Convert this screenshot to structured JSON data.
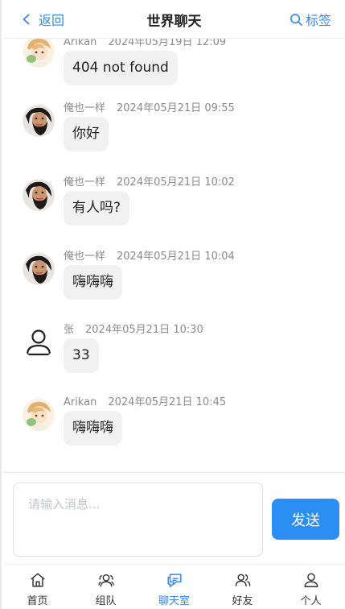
{
  "header": {
    "back_label": "返回",
    "title": "世界聊天",
    "tag_label": "标签"
  },
  "messages": [
    {
      "sender": "Arikan",
      "time": "2024年05月19日 12:09",
      "text": "404 not found",
      "avatar": "anime-avatar"
    },
    {
      "sender": "俺也一样",
      "time": "2024年05月21日 09:55",
      "text": "你好",
      "avatar": "bearded-avatar"
    },
    {
      "sender": "俺也一样",
      "time": "2024年05月21日 10:02",
      "text": "有人吗?",
      "avatar": "bearded-avatar"
    },
    {
      "sender": "俺也一样",
      "time": "2024年05月21日 10:04",
      "text": "嗨嗨嗨",
      "avatar": "bearded-avatar"
    },
    {
      "sender": "张",
      "time": "2024年05月21日 10:30",
      "text": "33",
      "avatar": "user-outline-icon"
    },
    {
      "sender": "Arikan",
      "time": "2024年05月21日 10:45",
      "text": "嗨嗨嗨",
      "avatar": "anime-avatar"
    }
  ],
  "composer": {
    "placeholder": "请输入消息...",
    "send_label": "发送"
  },
  "tabs": [
    {
      "label": "首页",
      "icon": "home-icon",
      "active": false
    },
    {
      "label": "组队",
      "icon": "team-icon",
      "active": false
    },
    {
      "label": "聊天室",
      "icon": "chat-icon",
      "active": true
    },
    {
      "label": "好友",
      "icon": "friends-icon",
      "active": false
    },
    {
      "label": "个人",
      "icon": "profile-icon",
      "active": false
    }
  ],
  "colors": {
    "accent": "#3a86e8",
    "send_button": "#2b8ef3",
    "bubble": "#f1f1f1"
  }
}
